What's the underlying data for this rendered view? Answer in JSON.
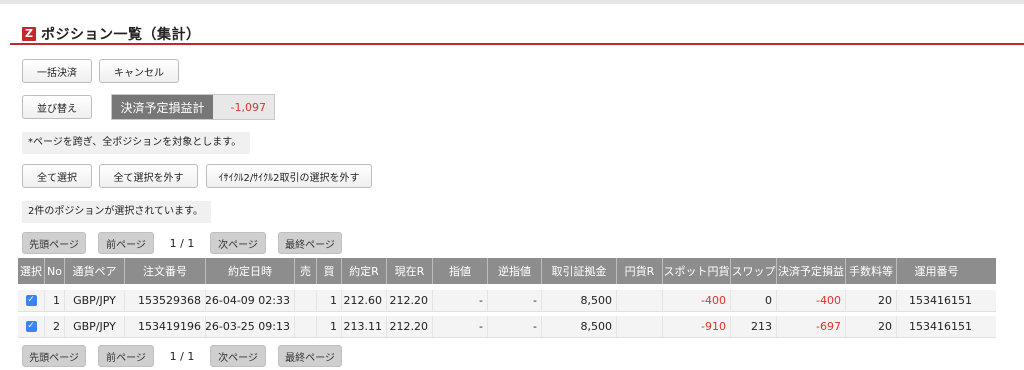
{
  "title": "ポジション一覧（集計）",
  "logo_letter": "Z",
  "buttons": {
    "bulk_settle": "一括決済",
    "cancel": "キャンセル",
    "sort": "並び替え",
    "select_all": "全て選択",
    "deselect_all": "全て選択を外す",
    "deselect_cycle": "ｲｻｲｸﾙ2/ｻｲｸﾙ2取引の選択を外す"
  },
  "pl_summary": {
    "label": "決済予定損益計",
    "value": "-1,097"
  },
  "notes": {
    "cross_page": "*ページを跨ぎ、全ポジションを対象とします。",
    "selected": "2件のポジションが選択されています。"
  },
  "pager": {
    "first": "先頭ページ",
    "prev": "前ページ",
    "info": "1 / 1",
    "next": "次ページ",
    "last": "最終ページ"
  },
  "table": {
    "headers": [
      "選択",
      "No",
      "通貨ペア",
      "注文番号",
      "約定日時",
      "売",
      "買",
      "約定R",
      "現在R",
      "指値",
      "逆指値",
      "取引証拠金",
      "円貨R",
      "スポット円貨",
      "スワップ",
      "決済予定損益",
      "手数料等",
      "運用番号"
    ],
    "rows": [
      [
        "✓",
        "1",
        "GBP/JPY",
        "153529368",
        "26-04-09 02:33",
        "",
        "1",
        "212.60",
        "212.20",
        "-",
        "-",
        "8,500",
        "",
        "-400",
        "0",
        "-400",
        "20",
        "153416151"
      ],
      [
        "✓",
        "2",
        "GBP/JPY",
        "153419196",
        "26-03-25 09:13",
        "",
        "1",
        "213.11",
        "212.20",
        "-",
        "-",
        "8,500",
        "",
        "-910",
        "213",
        "-697",
        "20",
        "153416151"
      ]
    ]
  },
  "colors": {
    "accent": "#c1272d",
    "negative": "#e0332f",
    "header_bg": "#8d8d8d"
  }
}
